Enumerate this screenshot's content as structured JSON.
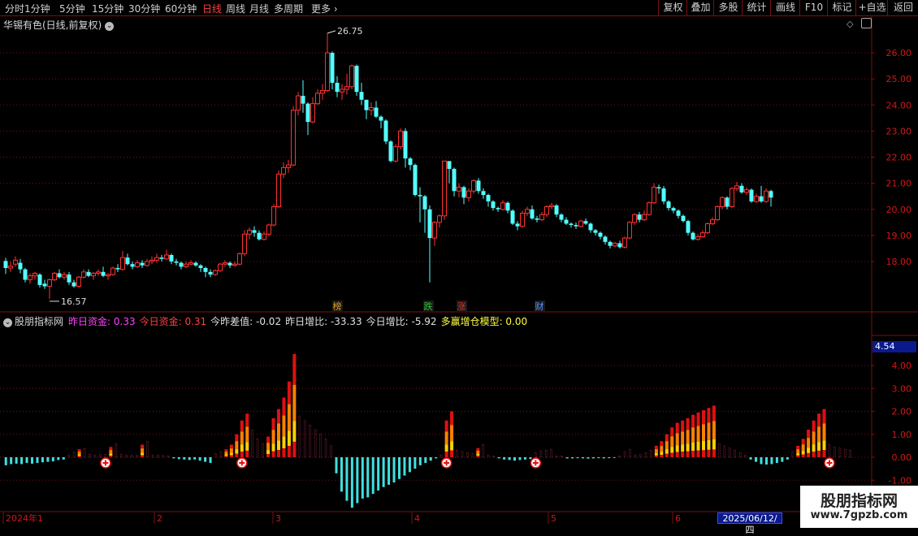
{
  "toolbar": {
    "periods": [
      "分时",
      "1分钟",
      "5分钟",
      "15分钟",
      "30分钟",
      "60分钟",
      "日线",
      "周线",
      "月线",
      "多周期",
      "更多"
    ],
    "active_period": "日线",
    "right_buttons": [
      "复权",
      "叠加",
      "多股",
      "统计",
      "画线",
      "F10",
      "标记",
      "+自选",
      "返回"
    ]
  },
  "stock": {
    "title": "华锡有色(日线,前复权)"
  },
  "price_axis": {
    "ticks": [
      "26.00",
      "25.00",
      "24.00",
      "23.00",
      "22.00",
      "21.00",
      "20.00",
      "19.00",
      "18.00"
    ],
    "high_label": "26.75",
    "low_label": "16.57"
  },
  "markers": [
    {
      "text": "榜",
      "color": "#e0a020"
    },
    {
      "text": "跌",
      "color": "#30c030"
    },
    {
      "text": "涨",
      "color": "#e03030"
    },
    {
      "text": "财",
      "color": "#6090ff"
    }
  ],
  "indicator": {
    "name": "股朋指标网",
    "items": [
      {
        "label": "昨日资金:",
        "value": "0.33",
        "color": "#ff40ff"
      },
      {
        "label": "今日资金:",
        "value": "0.31",
        "color": "#ff4040"
      },
      {
        "label": "今昨差值:",
        "value": "-0.02",
        "color": "#e0e0e0"
      },
      {
        "label": "昨日增比:",
        "value": "-33.33",
        "color": "#e0e0e0"
      },
      {
        "label": "今日增比:",
        "value": "-5.92",
        "color": "#e0e0e0"
      },
      {
        "label": "多赢增仓模型:",
        "value": "0.00",
        "color": "#ffff40"
      }
    ],
    "axis_ticks": [
      "4.00",
      "3.00",
      "2.00",
      "1.00",
      "0.00",
      "-1.00"
    ],
    "cursor_value": "4.54"
  },
  "time_axis": {
    "labels": [
      "2024年1",
      "2",
      "3",
      "4",
      "5",
      "6"
    ],
    "cursor_date": "2025/06/12/四"
  },
  "watermark": {
    "line1": "股朋指标网",
    "line2": "www.7gpzb.com"
  },
  "colors": {
    "up": "#ff3232",
    "down": "#54ffff",
    "grid": "#7a1010",
    "axis_text": "#d01818",
    "bar_red": "#e01010",
    "bar_orange": "#ff8000",
    "bar_yellow": "#ffd000",
    "bar_cyan": "#40e0e0"
  },
  "chart_data": {
    "type": "candlestick",
    "price_scale": {
      "min": 16.5,
      "max": 26.9
    },
    "candles": [
      [
        18.02,
        17.75,
        18.14,
        17.52
      ],
      [
        17.75,
        17.82,
        18.0,
        17.6
      ],
      [
        17.9,
        18.05,
        18.2,
        17.8
      ],
      [
        17.95,
        17.7,
        18.1,
        17.55
      ],
      [
        17.7,
        17.3,
        17.75,
        17.2
      ],
      [
        17.3,
        17.45,
        17.55,
        17.15
      ],
      [
        17.45,
        17.55,
        17.6,
        17.3
      ],
      [
        17.5,
        17.1,
        17.55,
        17.0
      ],
      [
        17.15,
        17.05,
        17.3,
        16.95
      ],
      [
        17.05,
        17.3,
        17.35,
        16.57
      ],
      [
        17.3,
        17.55,
        17.6,
        17.25
      ],
      [
        17.55,
        17.4,
        17.7,
        17.35
      ],
      [
        17.4,
        17.5,
        17.6,
        17.3
      ],
      [
        17.5,
        17.2,
        17.6,
        17.1
      ],
      [
        17.2,
        17.05,
        17.3,
        17.0
      ],
      [
        17.05,
        17.4,
        17.45,
        17.0
      ],
      [
        17.4,
        17.6,
        17.7,
        17.35
      ],
      [
        17.6,
        17.45,
        17.7,
        17.4
      ],
      [
        17.45,
        17.55,
        17.6,
        17.3
      ],
      [
        17.55,
        17.6,
        17.7,
        17.45
      ],
      [
        17.6,
        17.45,
        17.8,
        17.4
      ],
      [
        17.45,
        17.5,
        17.55,
        17.3
      ],
      [
        17.5,
        17.75,
        17.8,
        17.45
      ],
      [
        17.75,
        17.7,
        17.9,
        17.6
      ],
      [
        17.7,
        18.15,
        18.4,
        17.65
      ],
      [
        18.15,
        17.9,
        18.3,
        17.85
      ],
      [
        17.9,
        17.8,
        18.0,
        17.7
      ],
      [
        17.8,
        17.95,
        18.05,
        17.75
      ],
      [
        17.95,
        17.85,
        18.05,
        17.75
      ],
      [
        17.85,
        18.0,
        18.1,
        17.8
      ],
      [
        18.0,
        18.05,
        18.2,
        17.9
      ],
      [
        18.05,
        18.15,
        18.3,
        17.95
      ],
      [
        18.15,
        18.1,
        18.25,
        18.0
      ],
      [
        18.1,
        18.25,
        18.45,
        18.05
      ],
      [
        18.25,
        18.0,
        18.3,
        17.9
      ],
      [
        18.0,
        17.95,
        18.1,
        17.85
      ],
      [
        17.95,
        17.8,
        18.0,
        17.7
      ],
      [
        17.8,
        17.9,
        18.0,
        17.75
      ],
      [
        17.9,
        17.95,
        18.05,
        17.85
      ],
      [
        17.95,
        17.85,
        18.0,
        17.8
      ],
      [
        17.85,
        17.75,
        17.9,
        17.6
      ],
      [
        17.75,
        17.6,
        17.8,
        17.4
      ],
      [
        17.6,
        17.5,
        17.7,
        17.4
      ],
      [
        17.5,
        17.65,
        17.7,
        17.45
      ],
      [
        17.65,
        17.9,
        17.95,
        17.6
      ],
      [
        17.9,
        17.95,
        18.05,
        17.8
      ],
      [
        17.95,
        17.85,
        18.0,
        17.75
      ],
      [
        17.85,
        17.9,
        18.0,
        17.8
      ],
      [
        17.9,
        18.3,
        18.35,
        17.85
      ],
      [
        18.3,
        19.05,
        19.2,
        18.2
      ],
      [
        19.05,
        19.2,
        19.3,
        18.85
      ],
      [
        19.2,
        19.1,
        19.35,
        18.95
      ],
      [
        19.1,
        18.85,
        19.2,
        18.8
      ],
      [
        18.85,
        19.05,
        19.15,
        18.8
      ],
      [
        19.05,
        19.4,
        19.45,
        18.95
      ],
      [
        19.4,
        20.1,
        20.2,
        19.35
      ],
      [
        20.1,
        21.35,
        21.5,
        20.05
      ],
      [
        21.35,
        21.6,
        21.8,
        21.2
      ],
      [
        21.6,
        21.7,
        21.9,
        21.4
      ],
      [
        21.7,
        23.8,
        23.95,
        21.65
      ],
      [
        23.8,
        24.35,
        24.5,
        23.6
      ],
      [
        24.35,
        24.05,
        24.95,
        23.7
      ],
      [
        24.05,
        23.35,
        24.1,
        22.85
      ],
      [
        23.35,
        24.05,
        24.3,
        23.3
      ],
      [
        24.05,
        24.45,
        24.6,
        24.0
      ],
      [
        24.45,
        24.55,
        24.8,
        24.2
      ],
      [
        24.55,
        26.0,
        26.75,
        24.5
      ],
      [
        26.0,
        24.85,
        26.05,
        24.6
      ],
      [
        24.85,
        24.5,
        25.1,
        24.3
      ],
      [
        24.5,
        24.6,
        24.8,
        24.2
      ],
      [
        24.6,
        24.7,
        25.2,
        24.4
      ],
      [
        24.7,
        25.5,
        25.55,
        24.6
      ],
      [
        25.5,
        24.5,
        25.55,
        24.35
      ],
      [
        24.5,
        24.2,
        24.85,
        24.0
      ],
      [
        24.2,
        23.8,
        24.2,
        23.45
      ],
      [
        23.8,
        23.9,
        24.1,
        23.6
      ],
      [
        23.9,
        23.55,
        24.15,
        23.5
      ],
      [
        23.55,
        23.4,
        23.6,
        23.1
      ],
      [
        23.4,
        22.6,
        23.45,
        22.5
      ],
      [
        22.6,
        21.85,
        22.65,
        21.8
      ],
      [
        21.85,
        22.4,
        22.5,
        21.8
      ],
      [
        22.4,
        23.0,
        23.1,
        22.3
      ],
      [
        23.0,
        21.95,
        23.1,
        21.6
      ],
      [
        21.95,
        21.7,
        22.0,
        21.5
      ],
      [
        21.7,
        20.55,
        21.75,
        20.5
      ],
      [
        20.55,
        20.5,
        20.85,
        19.5
      ],
      [
        20.5,
        20.0,
        20.55,
        19.1
      ],
      [
        20.0,
        18.9,
        20.15,
        17.2
      ],
      [
        18.9,
        19.5,
        19.55,
        18.6
      ],
      [
        19.5,
        19.75,
        19.8,
        19.3
      ],
      [
        19.75,
        21.85,
        21.85,
        19.6
      ],
      [
        21.85,
        21.55,
        21.6,
        21.0
      ],
      [
        21.55,
        20.7,
        21.6,
        20.5
      ],
      [
        20.7,
        20.85,
        21.0,
        20.45
      ],
      [
        20.85,
        20.45,
        20.9,
        20.2
      ],
      [
        20.45,
        20.7,
        20.8,
        20.3
      ],
      [
        20.7,
        21.1,
        21.15,
        20.6
      ],
      [
        21.1,
        20.7,
        21.2,
        20.6
      ],
      [
        20.7,
        20.55,
        20.8,
        20.4
      ],
      [
        20.55,
        20.3,
        20.6,
        20.1
      ],
      [
        20.3,
        20.05,
        20.35,
        19.95
      ],
      [
        20.05,
        20.0,
        20.1,
        19.9
      ],
      [
        20.0,
        20.25,
        20.35,
        19.95
      ],
      [
        20.25,
        19.95,
        20.3,
        19.85
      ],
      [
        19.95,
        19.45,
        20.0,
        19.4
      ],
      [
        19.45,
        19.35,
        19.55,
        19.2
      ],
      [
        19.35,
        19.85,
        19.95,
        19.3
      ],
      [
        19.85,
        20.0,
        20.1,
        19.75
      ],
      [
        20.0,
        19.65,
        20.15,
        19.6
      ],
      [
        19.65,
        19.6,
        19.75,
        19.5
      ],
      [
        19.6,
        19.8,
        19.9,
        19.55
      ],
      [
        19.8,
        20.1,
        20.15,
        19.7
      ],
      [
        20.1,
        20.15,
        20.25,
        20.0
      ],
      [
        20.15,
        19.8,
        20.2,
        19.7
      ],
      [
        19.8,
        19.6,
        19.85,
        19.5
      ],
      [
        19.6,
        19.45,
        19.7,
        19.4
      ],
      [
        19.45,
        19.4,
        19.5,
        19.3
      ],
      [
        19.4,
        19.35,
        19.5,
        19.25
      ],
      [
        19.35,
        19.55,
        19.6,
        19.3
      ],
      [
        19.55,
        19.45,
        19.65,
        19.4
      ],
      [
        19.45,
        19.2,
        19.5,
        19.1
      ],
      [
        19.2,
        19.1,
        19.25,
        19.0
      ],
      [
        19.1,
        18.95,
        19.15,
        18.85
      ],
      [
        18.95,
        18.75,
        19.0,
        18.65
      ],
      [
        18.75,
        18.6,
        18.8,
        18.5
      ],
      [
        18.6,
        18.7,
        18.75,
        18.55
      ],
      [
        18.7,
        18.55,
        18.8,
        18.5
      ],
      [
        18.55,
        18.9,
        18.95,
        18.5
      ],
      [
        18.9,
        19.5,
        19.55,
        18.85
      ],
      [
        19.5,
        19.8,
        19.85,
        19.4
      ],
      [
        19.8,
        19.6,
        19.9,
        19.5
      ],
      [
        19.6,
        19.8,
        19.95,
        19.55
      ],
      [
        19.8,
        20.25,
        20.3,
        19.75
      ],
      [
        20.25,
        20.85,
        21.0,
        20.2
      ],
      [
        20.85,
        20.8,
        20.95,
        20.6
      ],
      [
        20.8,
        20.3,
        20.9,
        20.2
      ],
      [
        20.3,
        20.05,
        20.35,
        19.95
      ],
      [
        20.05,
        19.95,
        20.1,
        19.85
      ],
      [
        19.95,
        19.75,
        20.0,
        19.65
      ],
      [
        19.75,
        19.55,
        19.8,
        19.5
      ],
      [
        19.55,
        19.1,
        19.6,
        19.0
      ],
      [
        19.1,
        18.85,
        19.15,
        18.8
      ],
      [
        18.85,
        18.95,
        19.05,
        18.8
      ],
      [
        18.95,
        19.1,
        19.2,
        18.9
      ],
      [
        19.1,
        19.45,
        19.5,
        19.05
      ],
      [
        19.45,
        19.6,
        19.7,
        19.4
      ],
      [
        19.6,
        20.1,
        20.15,
        19.55
      ],
      [
        20.1,
        20.45,
        20.5,
        20.0
      ],
      [
        20.45,
        20.1,
        20.5,
        20.0
      ],
      [
        20.1,
        20.8,
        20.85,
        20.05
      ],
      [
        20.8,
        20.9,
        21.05,
        20.7
      ],
      [
        20.9,
        20.65,
        21.0,
        20.6
      ],
      [
        20.65,
        20.75,
        20.85,
        20.55
      ],
      [
        20.75,
        20.3,
        20.8,
        20.25
      ],
      [
        20.3,
        20.5,
        20.6,
        20.25
      ],
      [
        20.5,
        20.3,
        20.9,
        20.25
      ],
      [
        20.3,
        20.7,
        20.8,
        20.25
      ],
      [
        20.7,
        20.45,
        20.75,
        20.1
      ]
    ],
    "fund_model": [
      -0.35,
      -0.3,
      -0.28,
      -0.3,
      -0.25,
      -0.28,
      -0.25,
      -0.22,
      -0.2,
      -0.18,
      -0.12,
      -0.1,
      0.1,
      0.22,
      0.35,
      0.38,
      0.12,
      0.1,
      0.12,
      0.12,
      0.45,
      0.6,
      0.12,
      0.1,
      0.1,
      0.08,
      0.55,
      0.7,
      0.1,
      0.1,
      0.08,
      0.05,
      -0.05,
      -0.08,
      -0.1,
      -0.12,
      -0.1,
      -0.15,
      -0.2,
      -0.25,
      0.15,
      0.25,
      0.35,
      0.55,
      1.0,
      1.6,
      1.9,
      1.2,
      0.8,
      0.6,
      0.9,
      1.7,
      2.1,
      2.6,
      3.3,
      4.5,
      1.8,
      1.6,
      1.4,
      1.2,
      1.0,
      0.8,
      0.5,
      -0.7,
      -1.5,
      -1.9,
      -2.2,
      -2.0,
      -1.8,
      -1.75,
      -1.6,
      -1.45,
      -1.3,
      -1.2,
      -1.1,
      -0.95,
      -0.8,
      -0.65,
      -0.5,
      -0.35,
      -0.25,
      -0.15,
      -0.05,
      0.1,
      1.6,
      2.0,
      0.3,
      0.25,
      0.2,
      0.15,
      0.4,
      0.55,
      0.1,
      0.05,
      -0.05,
      -0.1,
      -0.12,
      -0.15,
      -0.12,
      -0.1,
      -0.08,
      0.2,
      0.28,
      0.3,
      0.35,
      0.05,
      0.05,
      -0.05,
      -0.05,
      -0.04,
      -0.05,
      -0.06,
      -0.05,
      -0.04,
      -0.05,
      -0.04,
      -0.03,
      0.05,
      0.25,
      0.35,
      0.1,
      0.12,
      0.2,
      0.3,
      0.5,
      0.7,
      1.0,
      1.3,
      1.5,
      1.6,
      1.7,
      1.85,
      1.95,
      2.05,
      2.15,
      2.25,
      0.6,
      0.5,
      0.4,
      0.3,
      0.2,
      0.1,
      -0.1,
      -0.2,
      -0.3,
      -0.32,
      -0.3,
      -0.25,
      -0.2,
      -0.1,
      0.25,
      0.5,
      0.8,
      1.2,
      1.6,
      1.9,
      2.1,
      0.55,
      0.45,
      0.4,
      0.35,
      0.3
    ],
    "signal_points": [
      19,
      45,
      84,
      101,
      157
    ]
  }
}
